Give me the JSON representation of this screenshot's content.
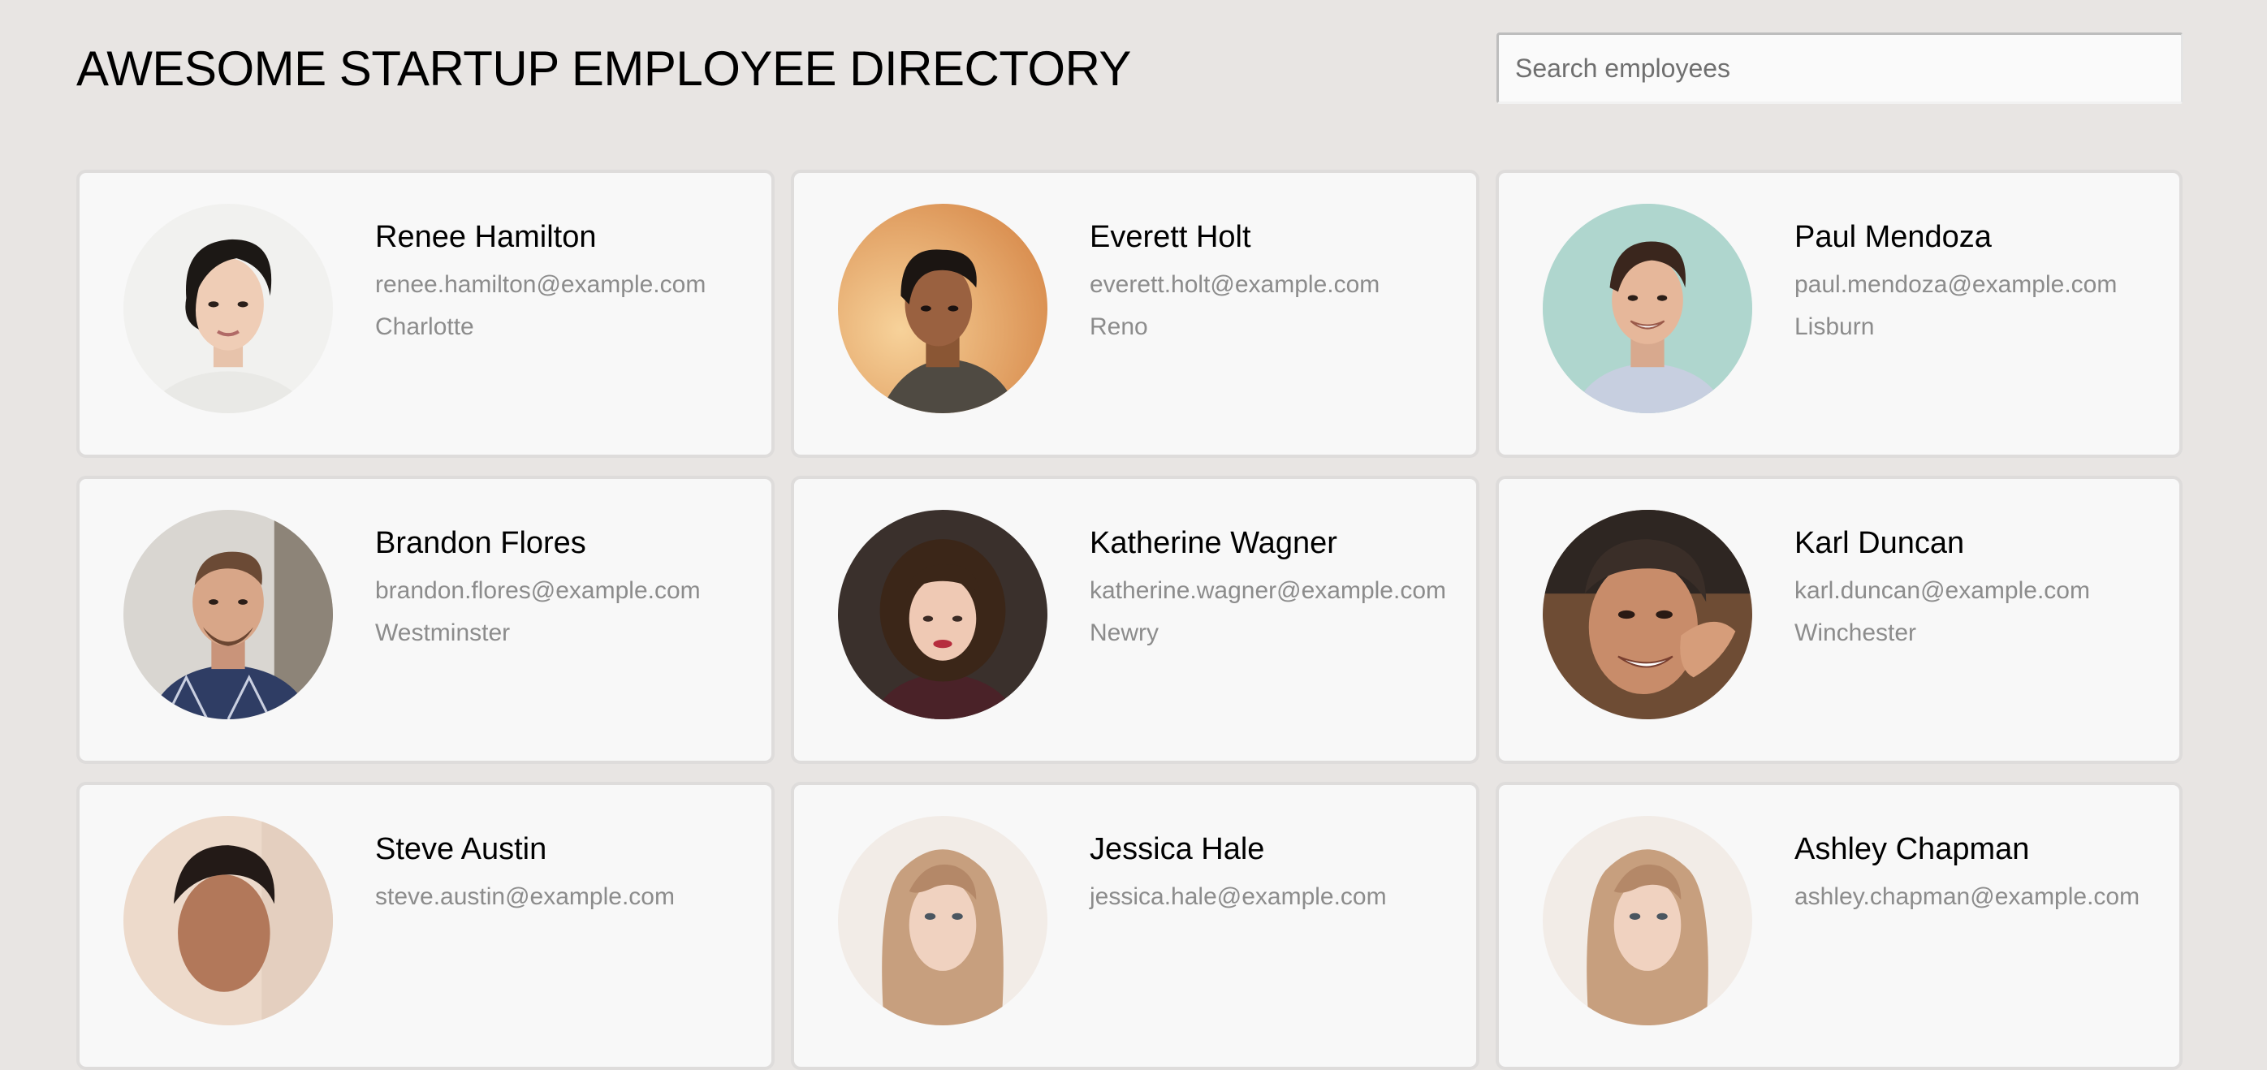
{
  "page": {
    "title": "AWESOME STARTUP EMPLOYEE DIRECTORY"
  },
  "search": {
    "placeholder": "Search employees",
    "value": ""
  },
  "employees": [
    {
      "name": "Renee Hamilton",
      "email": "renee.hamilton@example.com",
      "city": "Charlotte"
    },
    {
      "name": "Everett Holt",
      "email": "everett.holt@example.com",
      "city": "Reno"
    },
    {
      "name": "Paul Mendoza",
      "email": "paul.mendoza@example.com",
      "city": "Lisburn"
    },
    {
      "name": "Brandon Flores",
      "email": "brandon.flores@example.com",
      "city": "Westminster"
    },
    {
      "name": "Katherine Wagner",
      "email": "katherine.wagner@example.com",
      "city": "Newry"
    },
    {
      "name": "Karl Duncan",
      "email": "karl.duncan@example.com",
      "city": "Winchester"
    },
    {
      "name": "Steve Austin",
      "email": "steve.austin@example.com",
      "city": ""
    },
    {
      "name": "Jessica Hale",
      "email": "jessica.hale@example.com",
      "city": ""
    },
    {
      "name": "Ashley Chapman",
      "email": "ashley.chapman@example.com",
      "city": ""
    }
  ],
  "colors": {
    "background": "#e8e5e3",
    "card": "#f8f8f8",
    "card_border": "#dedcdb",
    "secondary_text": "#8c8c8c"
  }
}
